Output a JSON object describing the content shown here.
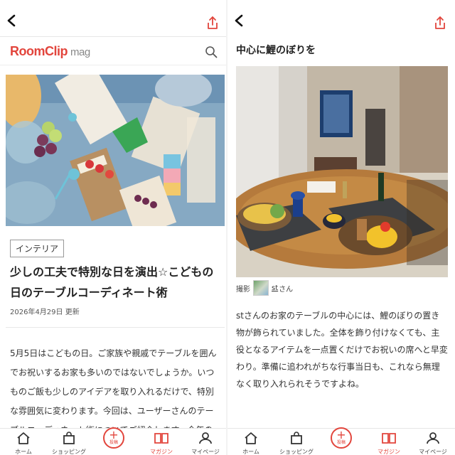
{
  "left": {
    "brand": {
      "logo_main": "RoomClip",
      "logo_sub": "mag"
    },
    "article": {
      "category": "インテリア",
      "title": "少しの工夫で特別な日を演出☆こどもの日のテーブルコーディネート術",
      "date": "2026年4月29日 更新",
      "body": "5月5日はこどもの日。ご家族や親戚でテーブルを囲んでお祝いするお家も多いのではないでしょうか。いつものご飯も少しのアイデアを取り入れるだけで、特別な雰囲気に変わります。今回は、ユーザーさんのテーブルコーディネート術についてご紹介します。今年のこどもの日を彩るヒント"
    }
  },
  "right": {
    "section_title": "中心に鯉のぼりを",
    "credit_label": "撮影",
    "credit_user": "st",
    "credit_suffix": "さん",
    "description": "stさんのお家のテーブルの中心には、鯉のぼりの置き物が飾られていました。全体を飾り付けなくても、主役となるアイテムを一点置くだけでお祝いの席へと早変わり。準備に追われがちな行事当日も、これなら無理なく取り入れられそうですよね。"
  },
  "tabbar": {
    "tabs": [
      {
        "label": "ホーム",
        "icon": "home-icon"
      },
      {
        "label": "ショッピング",
        "icon": "shopping-bag-icon"
      },
      {
        "label": "投稿",
        "icon": "plus-icon"
      },
      {
        "label": "マガジン",
        "icon": "magazine-icon"
      },
      {
        "label": "マイページ",
        "icon": "user-icon"
      }
    ],
    "active_index": 3
  },
  "colors": {
    "accent": "#e2453c"
  }
}
